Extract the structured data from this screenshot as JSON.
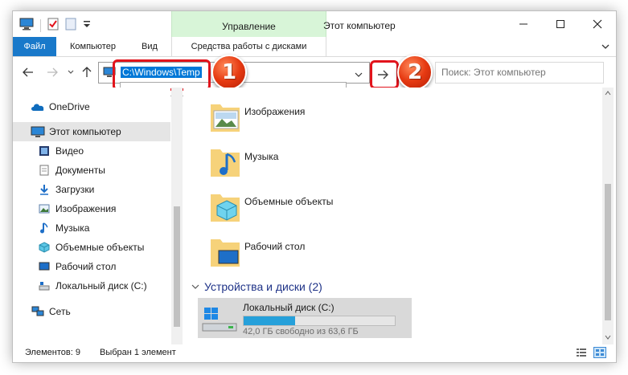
{
  "window": {
    "title": "Этот компьютер",
    "ribbon_context_title": "Управление"
  },
  "tabs": {
    "file": "Файл",
    "computer": "Компьютер",
    "view": "Вид",
    "disk_tools": "Средства работы с дисками"
  },
  "address": {
    "value": "C:\\Windows\\Temp",
    "search_placeholder": "Поиск: Этот компьютер"
  },
  "callouts": [
    "1",
    "2"
  ],
  "sidebar": {
    "items": [
      {
        "label": "OneDrive",
        "icon": "cloud-icon"
      },
      {
        "label": "Этот компьютер",
        "icon": "computer-icon",
        "selected": true
      },
      {
        "label": "Видео",
        "icon": "video-icon"
      },
      {
        "label": "Документы",
        "icon": "document-icon"
      },
      {
        "label": "Загрузки",
        "icon": "download-icon"
      },
      {
        "label": "Изображения",
        "icon": "pictures-icon"
      },
      {
        "label": "Музыка",
        "icon": "music-icon"
      },
      {
        "label": "Объемные объекты",
        "icon": "3d-objects-icon"
      },
      {
        "label": "Рабочий стол",
        "icon": "desktop-icon"
      },
      {
        "label": "Локальный диск (C:)",
        "icon": "drive-icon"
      },
      {
        "label": "Сеть",
        "icon": "network-icon"
      }
    ]
  },
  "content": {
    "folders": [
      {
        "label": "Изображения",
        "icon": "pictures-folder-icon"
      },
      {
        "label": "Музыка",
        "icon": "music-folder-icon"
      },
      {
        "label": "Объемные объекты",
        "icon": "3d-objects-folder-icon"
      },
      {
        "label": "Рабочий стол",
        "icon": "desktop-folder-icon"
      }
    ],
    "devices_group": "Устройства и диски (2)",
    "drive": {
      "name": "Локальный диск (C:)",
      "info": "42,0 ГБ свободно из 63,6 ГБ",
      "used_fraction": 0.34
    }
  },
  "status": {
    "items_count": "Элементов: 9",
    "selected": "Выбран 1 элемент"
  },
  "colors": {
    "accent": "#1979ca",
    "selection": "#0078d7",
    "callout_red": "#e2141c",
    "ribbon_context": "#d8f5d8"
  }
}
